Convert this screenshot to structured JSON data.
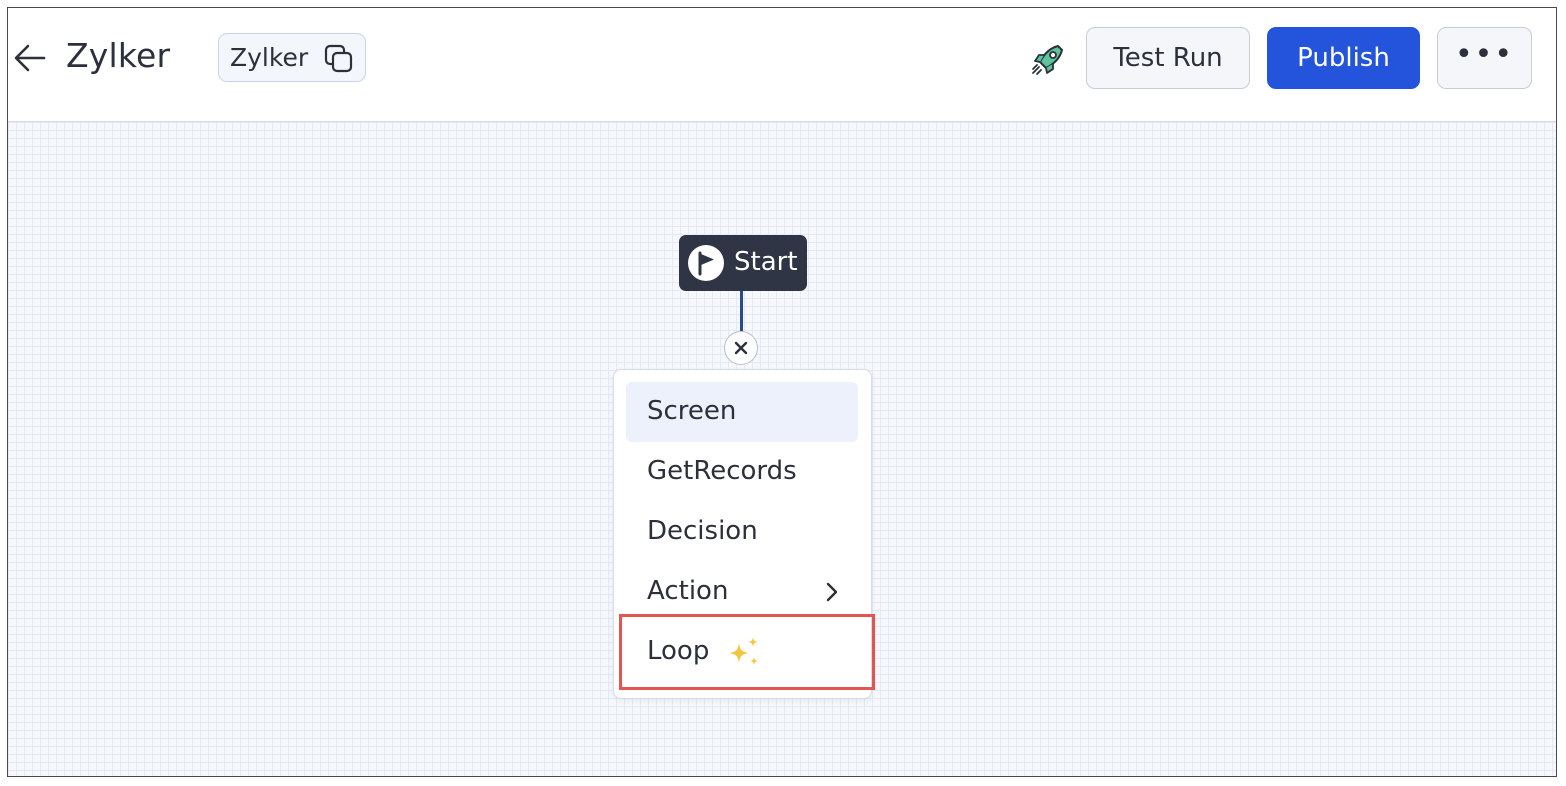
{
  "header": {
    "back_icon": "arrow-left-icon",
    "title": "Zylker",
    "name_chip": {
      "label": "Zylker",
      "icon": "copy-icon"
    },
    "rocket_icon": "rocket-icon",
    "test_run_label": "Test Run",
    "publish_label": "Publish",
    "more_label": "•••"
  },
  "canvas": {
    "start_node": {
      "icon": "flag-icon",
      "label": "Start"
    },
    "close_icon": "close-icon",
    "menu": {
      "items": [
        {
          "label": "Screen",
          "selected": true
        },
        {
          "label": "GetRecords"
        },
        {
          "label": "Decision"
        },
        {
          "label": "Action",
          "icon": "chevron-right-icon"
        },
        {
          "label": "Loop",
          "icon": "sparkle-icon",
          "highlighted": true
        }
      ]
    }
  },
  "colors": {
    "accent": "#2354db",
    "start_node_bg": "#2f3545",
    "highlight": "#e45450",
    "sparkle": "#f5c542",
    "rocket_body": "#5cc39a",
    "canvas_bg": "#f6f8fe"
  }
}
